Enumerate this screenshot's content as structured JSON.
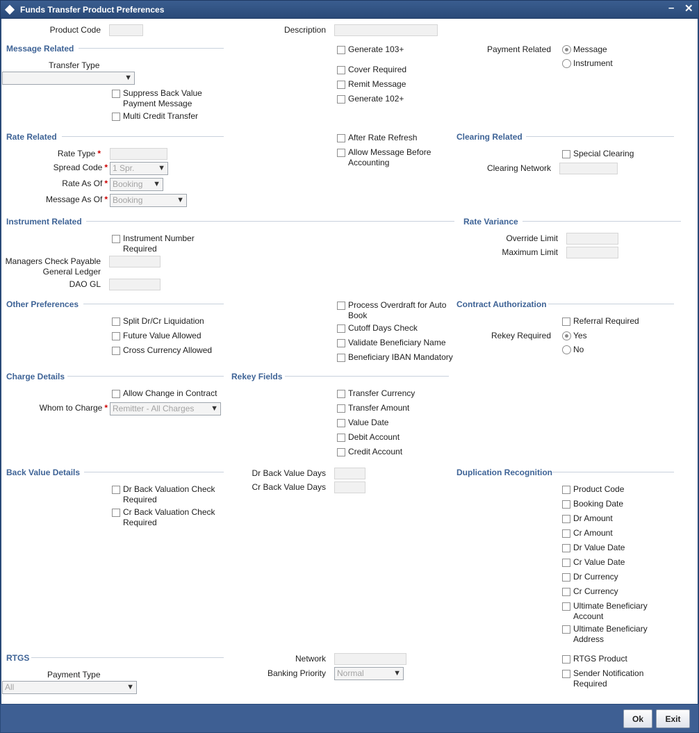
{
  "window": {
    "title": "Funds Transfer Product Preferences",
    "minimize_glyph": "–",
    "close_glyph": "✕"
  },
  "req_mark": "*",
  "header": {
    "product_code_label": "Product Code",
    "description_label": "Description"
  },
  "message_related": {
    "title": "Message Related",
    "transfer_type_label": "Transfer Type",
    "suppress_back_value_line1": "Suppress Back Value",
    "suppress_back_value_line2": "Payment Message",
    "multi_credit_transfer": "Multi Credit Transfer",
    "generate_103": "Generate 103+",
    "cover_required": "Cover Required",
    "remit_message": "Remit Message",
    "generate_102": "Generate 102+",
    "payment_related_label": "Payment Related",
    "payment_message": "Message",
    "payment_instrument": "Instrument"
  },
  "rate_related": {
    "title": "Rate Related",
    "rate_type_label": "Rate Type",
    "spread_code_label": "Spread Code",
    "spread_code_value": "1 Spr.",
    "rate_as_of_label": "Rate As Of",
    "rate_as_of_value": "Booking",
    "message_as_of_label": "Message As Of",
    "message_as_of_value": "Booking",
    "after_rate_refresh": "After Rate Refresh",
    "allow_message_line1": "Allow Message Before",
    "allow_message_line2": "Accounting"
  },
  "clearing_related": {
    "title": "Clearing Related",
    "special_clearing": "Special Clearing",
    "clearing_network_label": "Clearing Network"
  },
  "instrument_related": {
    "title": "Instrument Related",
    "instrument_number_line1": "Instrument Number",
    "instrument_number_line2": "Required",
    "managers_check_line1": "Managers Check Payable",
    "managers_check_line2": "General Ledger",
    "dao_gl_label": "DAO GL"
  },
  "rate_variance": {
    "title": "Rate Variance",
    "override_limit_label": "Override Limit",
    "maximum_limit_label": "Maximum Limit"
  },
  "other_preferences": {
    "title": "Other Preferences",
    "split_dr_cr": "Split Dr/Cr Liquidation",
    "future_value": "Future Value Allowed",
    "cross_currency": "Cross Currency Allowed",
    "process_overdraft_line1": "Process Overdraft for Auto",
    "process_overdraft_line2": "Book",
    "cutoff_days": "Cutoff Days Check",
    "validate_beneficiary": "Validate Beneficiary Name",
    "beneficiary_iban": "Beneficiary IBAN Mandatory"
  },
  "contract_authorization": {
    "title": "Contract Authorization",
    "referral_required": "Referral Required",
    "rekey_required_label": "Rekey Required",
    "yes": "Yes",
    "no": "No"
  },
  "charge_details": {
    "title": "Charge Details",
    "allow_change": "Allow Change in Contract",
    "whom_to_charge_label": "Whom to Charge",
    "whom_to_charge_value": "Remitter - All Charges"
  },
  "rekey_fields": {
    "title": "Rekey Fields",
    "transfer_currency": "Transfer Currency",
    "transfer_amount": "Transfer Amount",
    "value_date": "Value Date",
    "debit_account": "Debit Account",
    "credit_account": "Credit Account"
  },
  "back_value_details": {
    "title": "Back Value Details",
    "dr_check_line1": "Dr Back Valuation Check",
    "dr_check_line2": "Required",
    "cr_check_line1": "Cr Back Valuation Check",
    "cr_check_line2": "Required",
    "dr_days_label": "Dr Back Value Days",
    "cr_days_label": "Cr Back Value Days"
  },
  "duplication_recognition": {
    "title": "Duplication Recognition",
    "product_code": "Product Code",
    "booking_date": "Booking Date",
    "dr_amount": "Dr Amount",
    "cr_amount": "Cr Amount",
    "dr_value_date": "Dr Value Date",
    "cr_value_date": "Cr Value Date",
    "dr_currency": "Dr Currency",
    "cr_currency": "Cr Currency",
    "ult_account_line1": "Ultimate Beneficiary",
    "ult_account_line2": "Account",
    "ult_address_line1": "Ultimate Beneficiary",
    "ult_address_line2": "Address"
  },
  "rtgs": {
    "title": "RTGS",
    "payment_type_label": "Payment Type",
    "payment_type_value": "All",
    "network_label": "Network",
    "banking_priority_label": "Banking Priority",
    "banking_priority_value": "Normal",
    "rtgs_product": "RTGS Product",
    "sender_notification_line1": "Sender Notification",
    "sender_notification_line2": "Required"
  },
  "footer": {
    "ok": "Ok",
    "exit": "Exit"
  },
  "icons": {
    "dropdown": "chevron-down-icon",
    "window": "diamond-icon"
  }
}
